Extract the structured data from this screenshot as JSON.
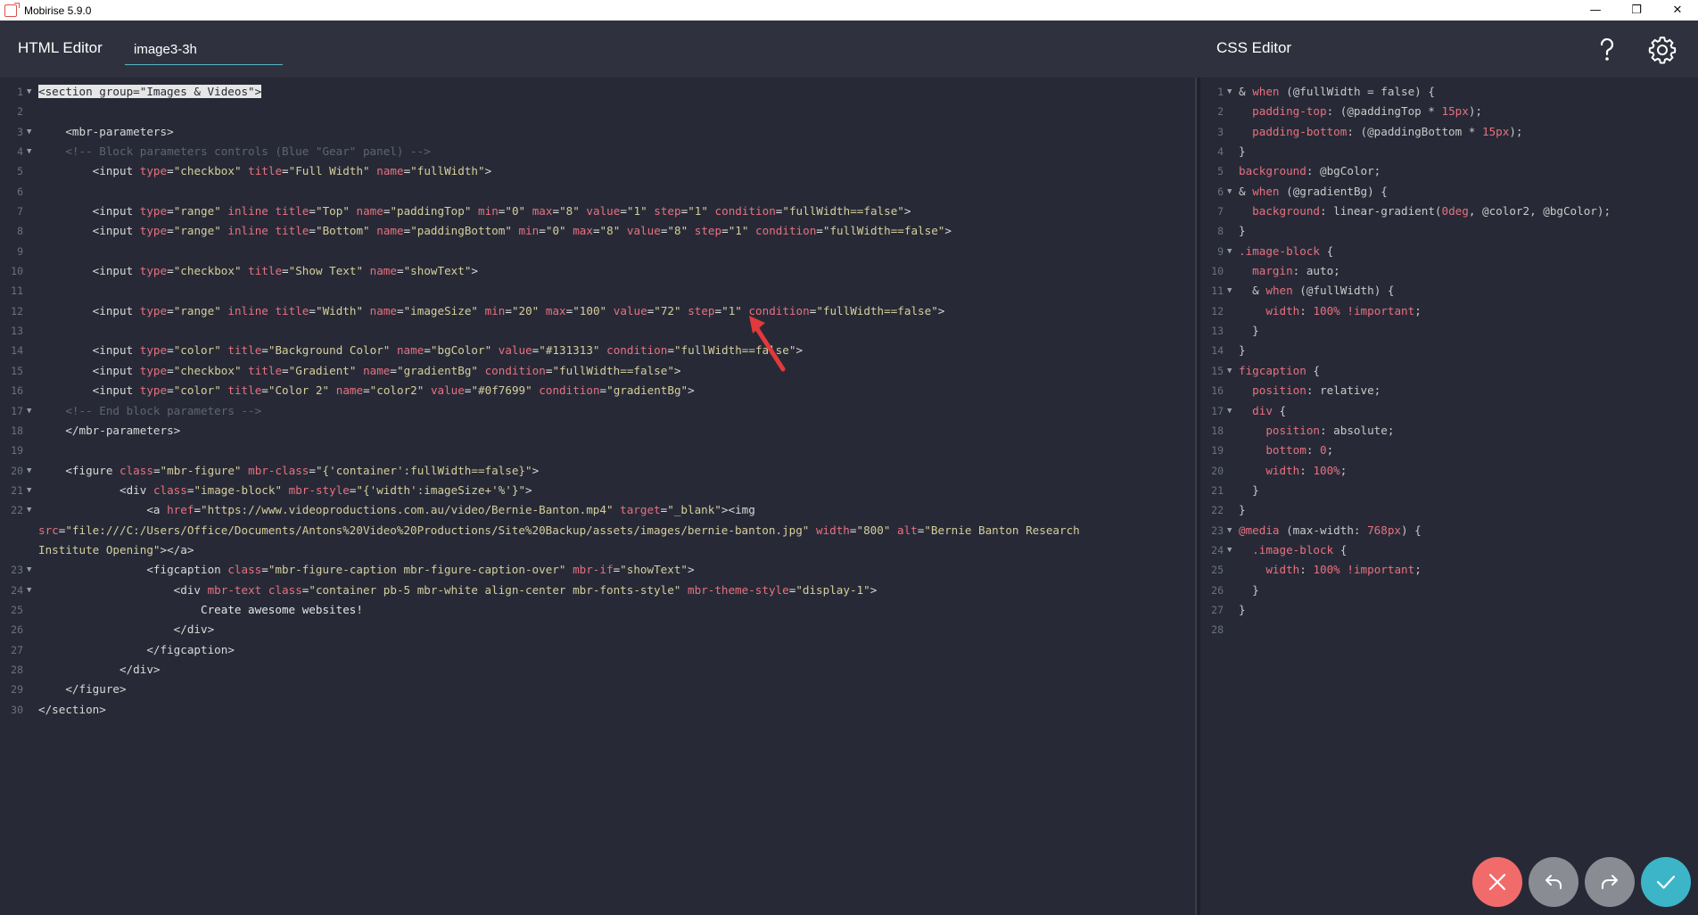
{
  "window": {
    "title": "Mobirise 5.9.0",
    "minimize": "—",
    "maximize": "❐",
    "close": "✕"
  },
  "header": {
    "html_editor_title": "HTML Editor",
    "block_name": "image3-3h",
    "css_editor_title": "CSS Editor"
  },
  "colors": {
    "accent": "#58b3c4",
    "cancel": "#f26b6b",
    "apply": "#3bb5c7",
    "neutral": "#8a8c93",
    "background": "#272a36"
  },
  "buttons": {
    "cancel": "cancel-icon",
    "undo": "undo-icon",
    "redo": "redo-icon",
    "apply": "check-icon"
  },
  "html_editor": {
    "line_numbers": [
      "1",
      "2",
      "3",
      "4",
      "5",
      "6",
      "7",
      "8",
      "9",
      "10",
      "11",
      "12",
      "13",
      "14",
      "15",
      "16",
      "17",
      "18",
      "19",
      "20",
      "21",
      "22",
      "",
      "",
      "23",
      "24",
      "25",
      "26",
      "27",
      "28",
      "29",
      "30"
    ]
  },
  "css_editor": {
    "line_numbers": [
      "1",
      "2",
      "3",
      "4",
      "5",
      "6",
      "7",
      "8",
      "9",
      "10",
      "11",
      "12",
      "13",
      "14",
      "15",
      "16",
      "17",
      "18",
      "19",
      "20",
      "21",
      "22",
      "23",
      "24",
      "25",
      "26",
      "27",
      "28"
    ]
  }
}
